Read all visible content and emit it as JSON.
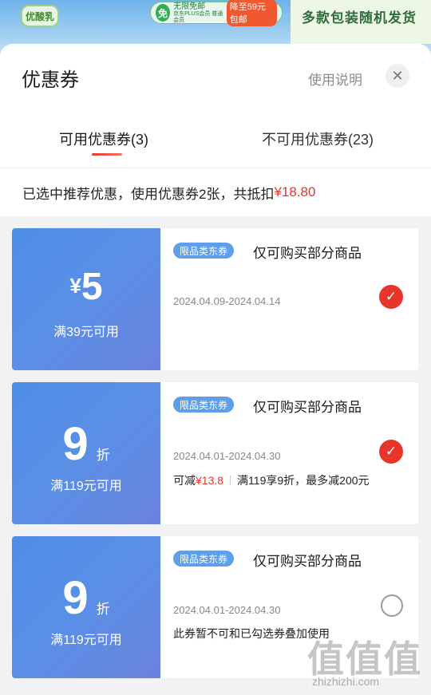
{
  "background": {
    "left_logo": "优酸乳",
    "promo_badge": "免",
    "promo_line1": "无限免邮",
    "promo_line2": "京东PLUS会员 普通会员",
    "promo_price": "降至59元包邮",
    "right_text": "多款包装随机发货"
  },
  "sheet": {
    "title": "优惠券",
    "help": "使用说明",
    "close_icon": "✕"
  },
  "tabs": [
    {
      "label": "可用优惠券(3)",
      "active": true
    },
    {
      "label": "不可用优惠券(23)",
      "active": false
    }
  ],
  "summary": {
    "text": "已选中推荐优惠，使用优惠券2张，共抵扣",
    "amount": "¥18.80"
  },
  "coupons": [
    {
      "currency": "¥",
      "value": "5",
      "unit": "",
      "condition": "满39元可用",
      "tag": "限品类东券",
      "scope": "仅可购买部分商品",
      "date": "2024.04.09-2024.04.14",
      "selected": true
    },
    {
      "currency": "",
      "value": "9",
      "unit": "折",
      "condition": "满119元可用",
      "tag": "限品类东券",
      "scope": "仅可购买部分商品",
      "date": "2024.04.01-2024.04.30",
      "extra_prefix": "可减",
      "extra_amount": "¥13.8",
      "extra_rule": "满119享9折，最多减200元",
      "selected": true
    },
    {
      "currency": "",
      "value": "9",
      "unit": "折",
      "condition": "满119元可用",
      "tag": "限品类东券",
      "scope": "仅可购买部分商品",
      "date": "2024.04.01-2024.04.30",
      "note": "此券暂不可和已勾选券叠加使用",
      "selected": false
    }
  ],
  "watermark": {
    "big": "值值值",
    "small": "zhizhizhi.com"
  },
  "colors": {
    "accent_red": "#e8352a",
    "coupon_blue": "#5b8fe6",
    "tag_blue": "#5f9ee8"
  }
}
